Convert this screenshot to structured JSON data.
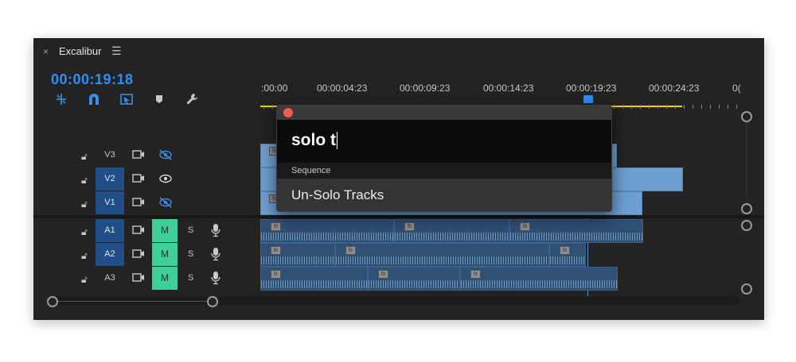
{
  "panel": {
    "close_glyph": "×",
    "title": "Excalibur",
    "menu_glyph": "☰",
    "timecode": "00:00:19:18"
  },
  "toolbar": {
    "icons": [
      "snap-nested-icon",
      "magnet-icon",
      "linked-selection-icon",
      "marker-icon",
      "wrench-icon"
    ]
  },
  "ruler": {
    "labels": [
      ":00:00",
      "00:00:04:23",
      "00:00:09:23",
      "00:00:14:23",
      "00:00:19:23",
      "00:00:24:23",
      "0("
    ]
  },
  "video_tracks": [
    {
      "name": "V3",
      "targeted": false,
      "visibility": "hidden"
    },
    {
      "name": "V2",
      "targeted": true,
      "visibility": "visible"
    },
    {
      "name": "V1",
      "targeted": true,
      "visibility": "hidden"
    }
  ],
  "audio_tracks": [
    {
      "name": "A1",
      "targeted": true,
      "mute": "M",
      "solo": "S"
    },
    {
      "name": "A2",
      "targeted": true,
      "mute": "M",
      "solo": "S"
    },
    {
      "name": "A3",
      "targeted": false,
      "mute": "M",
      "solo": "S"
    }
  ],
  "search_popup": {
    "query": "solo t",
    "category": "Sequence",
    "result": "Un-Solo Tracks"
  },
  "colors": {
    "accent": "#2f8ff7",
    "mute_active": "#3fcf9a",
    "work_area": "#f2d21d",
    "video_clip": "#6d9fd3",
    "audio_clip": "#2f4f73",
    "close_dot": "#f05a4f"
  }
}
